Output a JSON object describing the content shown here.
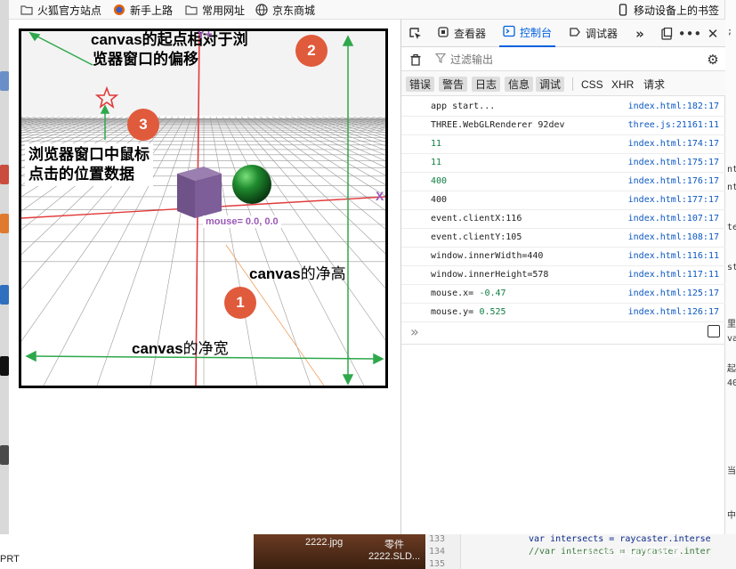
{
  "bookmarks": {
    "items": [
      {
        "label": "火狐官方站点",
        "icon": "folder-icon"
      },
      {
        "label": "新手上路",
        "icon": "firefox-icon"
      },
      {
        "label": "常用网址",
        "icon": "folder-icon"
      },
      {
        "label": "京东商城",
        "icon": "globe-icon"
      }
    ],
    "mobile": "移动设备上的书签"
  },
  "page": {
    "ann_canvas_offset": {
      "prefix": "canvas",
      "line1": "的起点相对于浏",
      "line2": "览器窗口的偏移"
    },
    "ann_click": {
      "line1": "浏览器窗口中鼠标",
      "line2": "点击的位置数据"
    },
    "ann_height": {
      "prefix": "canvas",
      "rest": "的净高"
    },
    "ann_width": {
      "prefix": "canvas",
      "rest": "的净宽"
    },
    "badges": [
      "1",
      "2",
      "3"
    ],
    "mouse_label": "mouse= 0.0, 0.0",
    "axis_y": "Y+",
    "axis_x": "X+"
  },
  "devtools": {
    "tabs": [
      {
        "label": "查看器",
        "icon": "inspector-icon"
      },
      {
        "label": "控制台",
        "icon": "console-icon"
      },
      {
        "label": "调试器",
        "icon": "debugger-icon"
      }
    ],
    "filter_placeholder": "过滤输出",
    "categories": [
      "错误",
      "警告",
      "日志",
      "信息",
      "调试"
    ],
    "categories2": [
      "CSS",
      "XHR",
      "请求"
    ],
    "logs": [
      {
        "text": "app start...",
        "src": "index.html:182:17",
        "kind": "plain"
      },
      {
        "text": "THREE.WebGLRenderer 92dev",
        "src": "three.js:21161:11",
        "kind": "plain"
      },
      {
        "text": "11",
        "src": "index.html:174:17",
        "kind": "green"
      },
      {
        "text": "11",
        "src": "index.html:175:17",
        "kind": "green"
      },
      {
        "text": "400",
        "src": "index.html:176:17",
        "kind": "green"
      },
      {
        "text": "400",
        "src": "index.html:177:17",
        "kind": "plain"
      },
      {
        "text": "event.clientX:116",
        "src": "index.html:107:17",
        "kind": "plain"
      },
      {
        "text": "event.clientY:105",
        "src": "index.html:108:17",
        "kind": "plain"
      },
      {
        "text": "window.innerWidth=440",
        "src": "index.html:116:11",
        "kind": "plain"
      },
      {
        "text": "window.innerHeight=578",
        "src": "index.html:117:11",
        "kind": "plain"
      },
      {
        "text": "mouse.x= ",
        "num": "-0.47",
        "src": "index.html:125:17",
        "kind": "mixed"
      },
      {
        "text": "mouse.y= ",
        "num": "0.525",
        "src": "index.html:126:17",
        "kind": "mixed"
      }
    ],
    "prompt": "»"
  },
  "taskbar": {
    "left_text": "PRT",
    "file1": "2222.jpg",
    "file2_line1": "零件",
    "file2_line2": "2222.SLD...",
    "code_lines": [
      {
        "num": "133",
        "text": "var intersects = raycaster.interse"
      },
      {
        "num": "134",
        "text": "//var intersects = raycaster.inter"
      },
      {
        "num": "135",
        "text": ""
      }
    ],
    "watermark": "CSDN @小白/阿部落"
  }
}
